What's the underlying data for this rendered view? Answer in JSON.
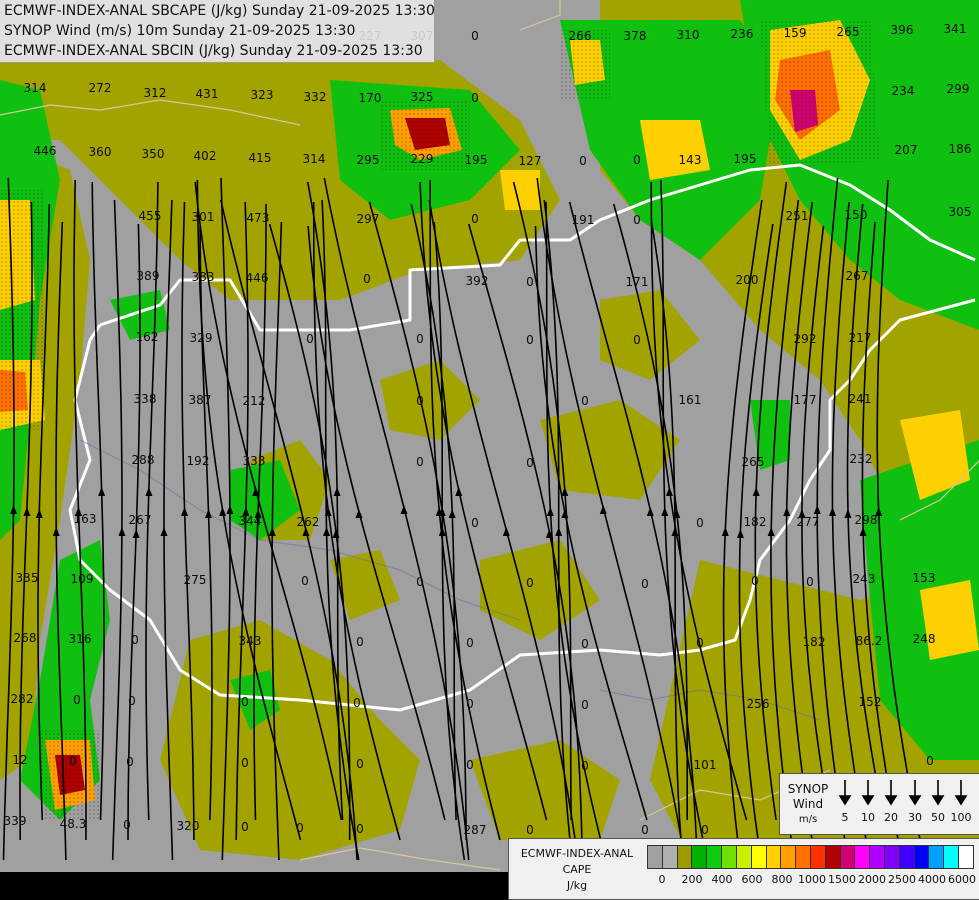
{
  "titles": {
    "line1": "ECMWF-INDEX-ANAL SBCAPE (J/kg) Sunday 21-09-2025 13:30",
    "line2": "SYNOP Wind (m/s) 10m Sunday 21-09-2025 13:30",
    "line3": "ECMWF-INDEX-ANAL SBCIN (J/kg) Sunday 21-09-2025 13:30"
  },
  "wind_legend": {
    "title": "SYNOP",
    "subtitle": "Wind",
    "unit": "m/s",
    "speeds": [
      "5",
      "10",
      "20",
      "30",
      "50",
      "100"
    ]
  },
  "cape_legend": {
    "model": "ECMWF-INDEX-ANAL",
    "param": "CAPE",
    "unit": "J/kg",
    "ticks": [
      "0",
      "200",
      "400",
      "600",
      "800",
      "1000",
      "1500",
      "2000",
      "2500",
      "4000",
      "6000"
    ],
    "colors": [
      "#a0a0a0",
      "#b0b0b0",
      "#9b9b00",
      "#00b000",
      "#10cc10",
      "#70e000",
      "#c8f000",
      "#ffff00",
      "#ffd000",
      "#ffa000",
      "#ff7000",
      "#ff3000",
      "#b00000",
      "#d00070",
      "#ff00ff",
      "#b000ff",
      "#8000ff",
      "#4000ff",
      "#0000ff",
      "#00a0ff",
      "#00ffff",
      "#ffffff"
    ]
  },
  "colors": {
    "sea": "#a0a0a0",
    "low_cape": "#a3a300",
    "border": "#ffffff"
  },
  "map_labels": [
    {
      "t": "314"
    },
    {
      "t": "272"
    },
    {
      "t": "312"
    },
    {
      "t": "431"
    },
    {
      "t": "323"
    },
    {
      "t": "332"
    },
    {
      "t": "170"
    },
    {
      "t": "325"
    },
    {
      "t": "0"
    },
    {
      "t": "227"
    },
    {
      "t": "307"
    },
    {
      "t": "0"
    },
    {
      "t": "266"
    },
    {
      "t": "378"
    },
    {
      "t": "310"
    },
    {
      "t": "236"
    },
    {
      "t": "159"
    },
    {
      "t": "265"
    },
    {
      "t": "396"
    },
    {
      "t": "341"
    },
    {
      "t": "446"
    },
    {
      "t": "360"
    },
    {
      "t": "350"
    },
    {
      "t": "402"
    },
    {
      "t": "415"
    },
    {
      "t": "314"
    },
    {
      "t": "295"
    },
    {
      "t": "229"
    },
    {
      "t": "195"
    },
    {
      "t": "127"
    },
    {
      "t": "0"
    },
    {
      "t": "0"
    },
    {
      "t": "143"
    },
    {
      "t": "195"
    },
    {
      "t": "234"
    },
    {
      "t": "299"
    },
    {
      "t": "455"
    },
    {
      "t": "301"
    },
    {
      "t": "473"
    },
    {
      "t": "297"
    },
    {
      "t": "0"
    },
    {
      "t": "191"
    },
    {
      "t": "0"
    },
    {
      "t": "251"
    },
    {
      "t": "150"
    },
    {
      "t": "207"
    },
    {
      "t": "186"
    },
    {
      "t": "389"
    },
    {
      "t": "383"
    },
    {
      "t": "446"
    },
    {
      "t": "0"
    },
    {
      "t": "392"
    },
    {
      "t": "0"
    },
    {
      "t": "171"
    },
    {
      "t": "200"
    },
    {
      "t": "267"
    },
    {
      "t": "305"
    },
    {
      "t": "162"
    },
    {
      "t": "329"
    },
    {
      "t": "0"
    },
    {
      "t": "0"
    },
    {
      "t": "0"
    },
    {
      "t": "0"
    },
    {
      "t": "292"
    },
    {
      "t": "217"
    },
    {
      "t": "338"
    },
    {
      "t": "387"
    },
    {
      "t": "212"
    },
    {
      "t": "0"
    },
    {
      "t": "0"
    },
    {
      "t": "161"
    },
    {
      "t": "177"
    },
    {
      "t": "241"
    },
    {
      "t": "288"
    },
    {
      "t": "192"
    },
    {
      "t": "333"
    },
    {
      "t": "0"
    },
    {
      "t": "0"
    },
    {
      "t": "265"
    },
    {
      "t": "232"
    },
    {
      "t": "163"
    },
    {
      "t": "267"
    },
    {
      "t": "344"
    },
    {
      "t": "262"
    },
    {
      "t": "0"
    },
    {
      "t": "0"
    },
    {
      "t": "182"
    },
    {
      "t": "277"
    },
    {
      "t": "298"
    },
    {
      "t": "335"
    },
    {
      "t": "109"
    },
    {
      "t": "275"
    },
    {
      "t": "0"
    },
    {
      "t": "0"
    },
    {
      "t": "0"
    },
    {
      "t": "0"
    },
    {
      "t": "0"
    },
    {
      "t": "0"
    },
    {
      "t": "243"
    },
    {
      "t": "153"
    },
    {
      "t": "268"
    },
    {
      "t": "316"
    },
    {
      "t": "0"
    },
    {
      "t": "343"
    },
    {
      "t": "0"
    },
    {
      "t": "0"
    },
    {
      "t": "0"
    },
    {
      "t": "0"
    },
    {
      "t": "182"
    },
    {
      "t": "86.2"
    },
    {
      "t": "248"
    },
    {
      "t": "282"
    },
    {
      "t": "0"
    },
    {
      "t": "0"
    },
    {
      "t": "0"
    },
    {
      "t": "0"
    },
    {
      "t": "0"
    },
    {
      "t": "0"
    },
    {
      "t": "256"
    },
    {
      "t": "152"
    },
    {
      "t": "12"
    },
    {
      "t": "0"
    },
    {
      "t": "0"
    },
    {
      "t": "0"
    },
    {
      "t": "0"
    },
    {
      "t": "0"
    },
    {
      "t": "0"
    },
    {
      "t": "101"
    },
    {
      "t": "0"
    },
    {
      "t": "339"
    },
    {
      "t": "48.3"
    },
    {
      "t": "0"
    },
    {
      "t": "320"
    },
    {
      "t": "0"
    },
    {
      "t": "0"
    },
    {
      "t": "0"
    },
    {
      "t": "287"
    },
    {
      "t": "0"
    },
    {
      "t": "0"
    },
    {
      "t": "0"
    }
  ]
}
